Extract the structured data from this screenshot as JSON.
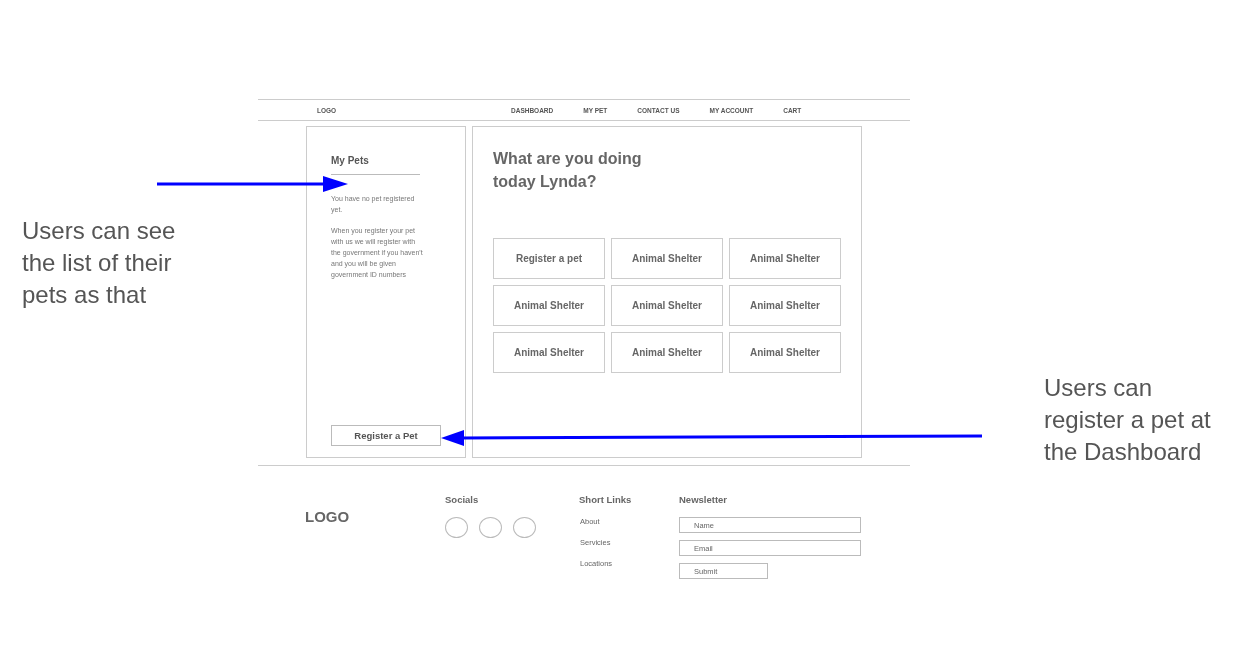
{
  "nav": {
    "logo": "LOGO",
    "items": [
      "DASHBOARD",
      "MY PET",
      "CONTACT US",
      "MY ACCOUNT",
      "CART"
    ]
  },
  "sidebar": {
    "title": "My Pets",
    "paragraphs": [
      "You have no pet registered yet.",
      "When you register your pet with us we will register with the government if you haven't and you will be given government ID numbers"
    ],
    "button": "Register a Pet"
  },
  "main": {
    "heading": "What are you doing today Lynda?",
    "tiles": [
      "Register a pet",
      "Animal Shelter",
      "Animal Shelter",
      "Animal Shelter",
      "Animal Shelter",
      "Animal Shelter",
      "Animal Shelter",
      "Animal Shelter",
      "Animal Shelter"
    ]
  },
  "footer": {
    "logo": "LOGO",
    "socials": {
      "title": "Socials"
    },
    "short_links": {
      "title": "Short Links",
      "links": [
        "About",
        "Servicies",
        "Locations"
      ]
    },
    "newsletter": {
      "title": "Newsletter",
      "name_placeholder": "Name",
      "email_placeholder": "Email",
      "submit": "Submit"
    }
  },
  "annotations": [
    {
      "text": "Users can see the list of their pets as that"
    },
    {
      "text": "Users can register a pet at the Dashboard"
    }
  ]
}
